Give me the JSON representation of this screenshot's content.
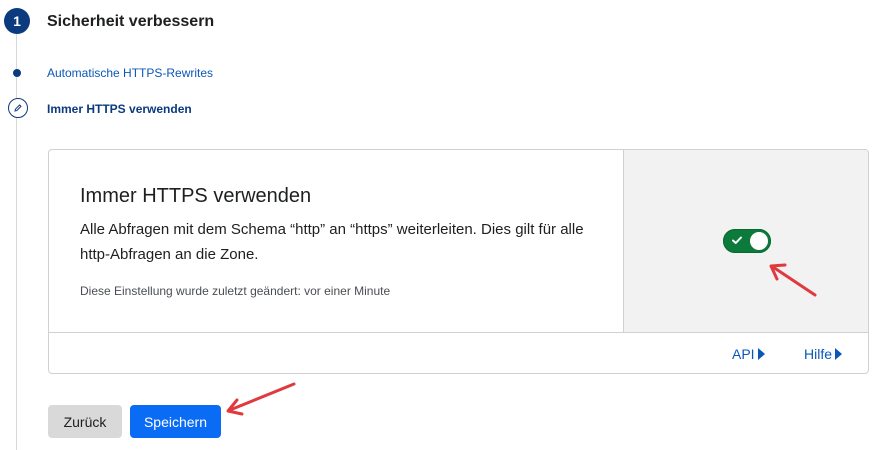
{
  "step": {
    "number": "1",
    "title": "Sicherheit verbessern"
  },
  "substeps": [
    {
      "label": "Automatische HTTPS-Rewrites"
    },
    {
      "label": "Immer HTTPS verwenden"
    }
  ],
  "card": {
    "title": "Immer HTTPS verwenden",
    "description": "Alle Abfragen mit dem Schema “http” an “https” weiterleiten. Dies gilt für alle http-Abfragen an die Zone.",
    "meta": "Diese Einstellung wurde zuletzt geändert: vor einer Minute",
    "toggle": {
      "state": "on",
      "color": "#0c7a3a"
    },
    "links": [
      {
        "label": "API"
      },
      {
        "label": "Hilfe"
      }
    ]
  },
  "buttons": {
    "back": "Zurück",
    "save": "Speichern"
  },
  "colors": {
    "primary": "#0a6cf5",
    "step_active": "#0b3a7e",
    "link": "#0b57b8",
    "annotation_arrow": "#e0393e"
  },
  "icons": [
    "edit-pencil-icon",
    "check-icon",
    "caret-right-icon",
    "arrow-annotation-icon"
  ]
}
